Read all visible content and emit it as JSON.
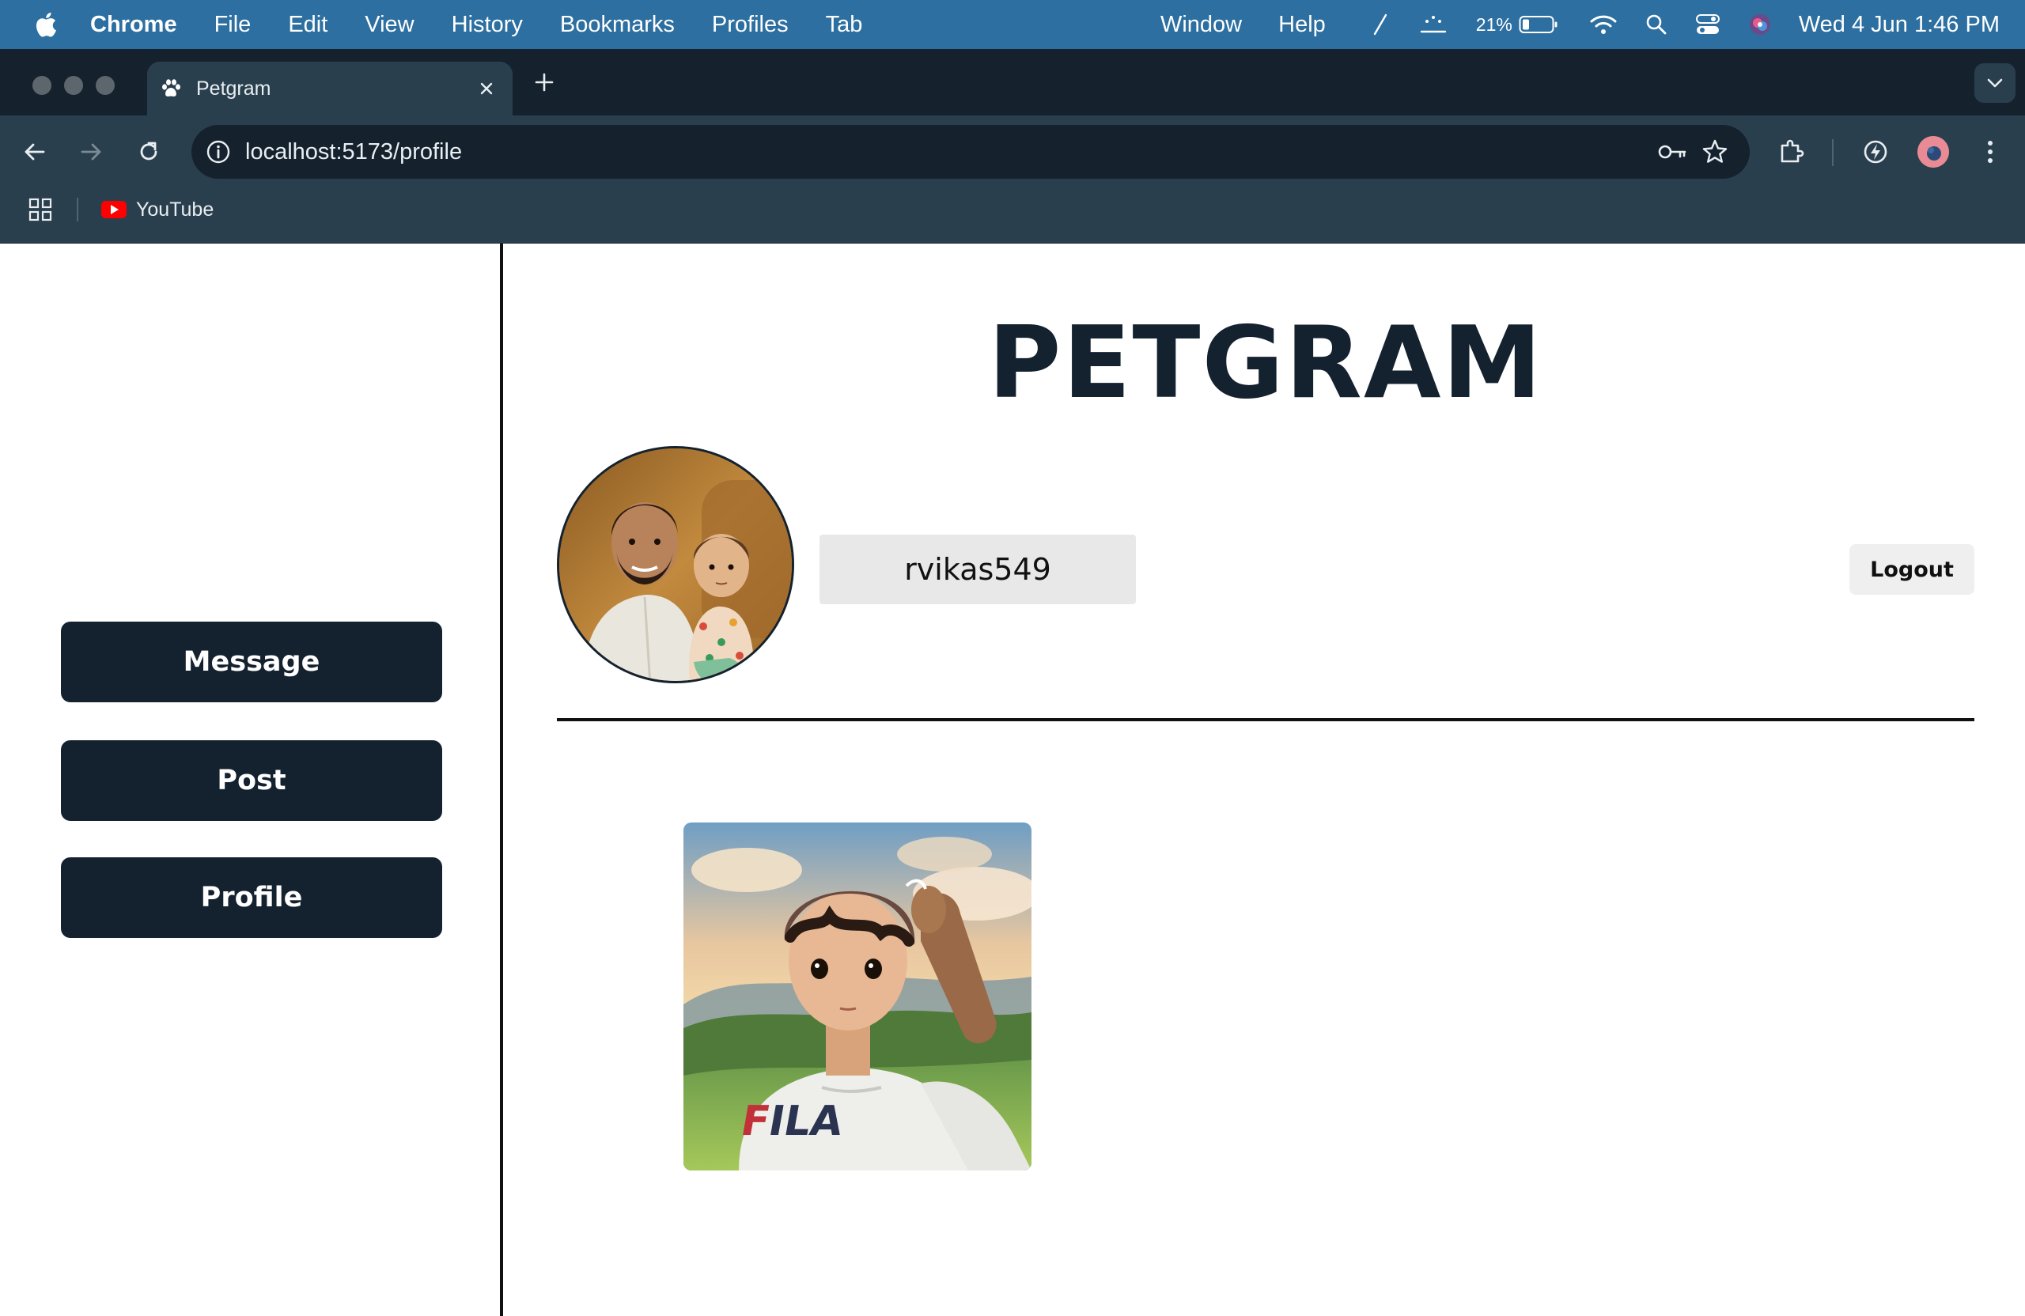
{
  "menubar": {
    "app_name": "Chrome",
    "items": [
      "File",
      "Edit",
      "View",
      "History",
      "Bookmarks",
      "Profiles",
      "Tab"
    ],
    "right_items": [
      "Window",
      "Help"
    ],
    "battery_percent": "21%",
    "datetime": "Wed 4 Jun  1:46 PM"
  },
  "browser": {
    "tab_title": "Petgram",
    "url": "localhost:5173/profile",
    "bookmarks": [
      {
        "label": "YouTube",
        "icon": "youtube-icon"
      }
    ]
  },
  "sidebar": {
    "buttons": [
      {
        "label": "Message"
      },
      {
        "label": "Post"
      },
      {
        "label": "Profile"
      }
    ]
  },
  "main": {
    "brand": "PETGRAM",
    "username": "rvikas549",
    "logout_label": "Logout"
  },
  "colors": {
    "menubar": "#2c6fa0",
    "chrome_dark": "#15222d",
    "chrome_toolbar": "#2a3f4d",
    "primary": "#14222f",
    "username_bg": "#e8e8e8"
  }
}
